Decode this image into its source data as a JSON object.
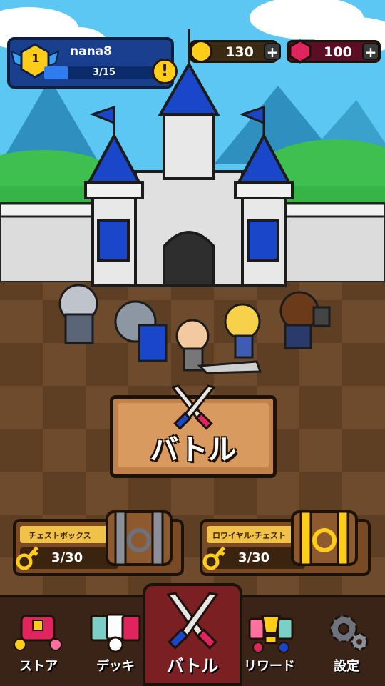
{
  "player": {
    "name": "nana8",
    "level": "1",
    "xp_text": "3/15",
    "xp_progress": 0.2
  },
  "resources": {
    "gold": "130",
    "gems": "100"
  },
  "battle_button": {
    "label": "バトル"
  },
  "chests": [
    {
      "title": "チェストボックス",
      "count": "3/30"
    },
    {
      "title": "ロワイヤル·チェスト",
      "count": "3/30"
    }
  ],
  "nav": {
    "items": [
      {
        "label": "ストア",
        "icon": "store-icon"
      },
      {
        "label": "デッキ",
        "icon": "deck-icon"
      },
      {
        "label": "バトル",
        "icon": "swords-icon"
      },
      {
        "label": "リワード",
        "icon": "reward-icon"
      },
      {
        "label": "設定",
        "icon": "gear-icon"
      }
    ],
    "active": 2
  },
  "colors": {
    "sky": "#5bc7f2",
    "ground": "#6b4a2b",
    "player_panel": "#1a3f8f",
    "gold": "#ffcc1a",
    "gem": "#e0245e",
    "nav_bg": "#3a2418",
    "nav_active": "#7a1f22"
  }
}
